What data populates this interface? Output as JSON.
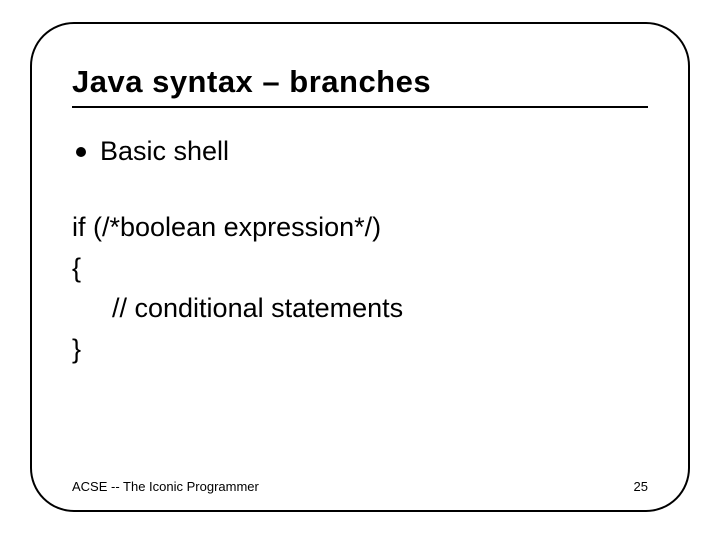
{
  "title": "Java syntax – branches",
  "bullet": "Basic shell",
  "code": {
    "line1": "if (/*boolean expression*/)",
    "line2": "{",
    "line3": "// conditional statements",
    "line4": "}"
  },
  "footer": {
    "left": "ACSE -- The Iconic Programmer",
    "right": "25"
  }
}
